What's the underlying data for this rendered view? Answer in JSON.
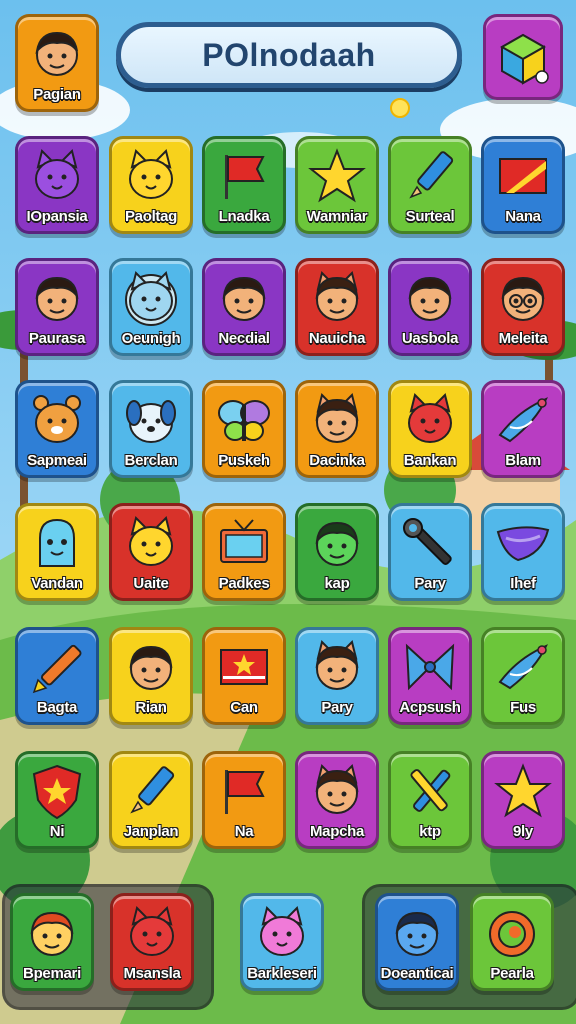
{
  "header": {
    "title": "POlnodaah",
    "profile_label": "Pagian",
    "profile_icon": "boy-face-icon",
    "menu_icon": "cube-logo-icon"
  },
  "colors": {
    "purple": "#8a36c4",
    "yellow": "#f7d21c",
    "green": "#3aa83e",
    "lightgreen": "#6cc63a",
    "blue": "#2f7fd6",
    "lightblue": "#52b8ea",
    "red": "#d8322a",
    "orange": "#f29a12",
    "magenta": "#b83dc2"
  },
  "grid": [
    [
      {
        "label": "IOpansia",
        "icon": "purple-cat-icon",
        "color": "purple"
      },
      {
        "label": "Paoltag",
        "icon": "yellow-cat-icon",
        "color": "yellow"
      },
      {
        "label": "Lnadka",
        "icon": "red-flag-icon",
        "color": "green"
      },
      {
        "label": "Wamniar",
        "icon": "star-icon",
        "color": "lightgreen"
      },
      {
        "label": "Surteal",
        "icon": "pen-icon",
        "color": "lightgreen"
      },
      {
        "label": "Nana",
        "icon": "striped-flag-icon",
        "color": "blue"
      }
    ],
    [
      {
        "label": "Paurasa",
        "icon": "boy-face-icon",
        "color": "purple"
      },
      {
        "label": "Oeunigh",
        "icon": "lion-face-icon",
        "color": "lightblue"
      },
      {
        "label": "Necdial",
        "icon": "boy-face-icon",
        "color": "purple"
      },
      {
        "label": "Nauicha",
        "icon": "cat-girl-face-icon",
        "color": "red"
      },
      {
        "label": "Uasbola",
        "icon": "boy-face-icon",
        "color": "purple"
      },
      {
        "label": "Meleita",
        "icon": "glasses-face-icon",
        "color": "red"
      }
    ],
    [
      {
        "label": "Sapmeai",
        "icon": "bear-face-icon",
        "color": "blue"
      },
      {
        "label": "Berclan",
        "icon": "dog-face-icon",
        "color": "lightblue"
      },
      {
        "label": "Puskeh",
        "icon": "butterfly-icon",
        "color": "orange"
      },
      {
        "label": "Dacinka",
        "icon": "cat-girl-face-icon",
        "color": "orange"
      },
      {
        "label": "Bankan",
        "icon": "red-cat-icon",
        "color": "yellow"
      },
      {
        "label": "Blam",
        "icon": "bird-icon",
        "color": "magenta"
      }
    ],
    [
      {
        "label": "Vandan",
        "icon": "blue-blob-icon",
        "color": "yellow"
      },
      {
        "label": "Uaite",
        "icon": "yellow-cat-icon",
        "color": "red"
      },
      {
        "label": "Padkes",
        "icon": "tv-icon",
        "color": "orange"
      },
      {
        "label": "kap",
        "icon": "green-face-icon",
        "color": "green"
      },
      {
        "label": "Pary",
        "icon": "wrench-icon",
        "color": "lightblue"
      },
      {
        "label": "Ihef",
        "icon": "wing-icon",
        "color": "lightblue"
      }
    ],
    [
      {
        "label": "Bagta",
        "icon": "crayon-icon",
        "color": "blue"
      },
      {
        "label": "Rian",
        "icon": "boy-face-icon",
        "color": "yellow"
      },
      {
        "label": "Can",
        "icon": "china-flag-icon",
        "color": "orange"
      },
      {
        "label": "Pary",
        "icon": "cat-girl-face-icon",
        "color": "lightblue"
      },
      {
        "label": "Acpsush",
        "icon": "bow-icon",
        "color": "magenta"
      },
      {
        "label": "Fus",
        "icon": "bird-icon",
        "color": "lightgreen"
      }
    ],
    [
      {
        "label": "Ni",
        "icon": "shield-star-icon",
        "color": "green"
      },
      {
        "label": "Janplan",
        "icon": "pen-icon",
        "color": "yellow"
      },
      {
        "label": "Na",
        "icon": "red-flag-icon",
        "color": "orange"
      },
      {
        "label": "Mapcha",
        "icon": "cat-girl-face-icon",
        "color": "magenta"
      },
      {
        "label": "ktp",
        "icon": "crossed-pens-icon",
        "color": "lightgreen"
      },
      {
        "label": "9ly",
        "icon": "star-icon",
        "color": "magenta"
      }
    ]
  ],
  "dock": [
    {
      "label": "Bpemari",
      "icon": "red-hair-face-icon",
      "color": "green"
    },
    {
      "label": "Msansla",
      "icon": "red-cat-icon",
      "color": "red"
    },
    {
      "label": "Barkleseri",
      "icon": "pink-cat-icon",
      "color": "lightblue"
    },
    {
      "label": "Doeanticai",
      "icon": "blue-boy-face-icon",
      "color": "blue"
    },
    {
      "label": "Pearla",
      "icon": "swirl-icon",
      "color": "lightgreen"
    }
  ]
}
